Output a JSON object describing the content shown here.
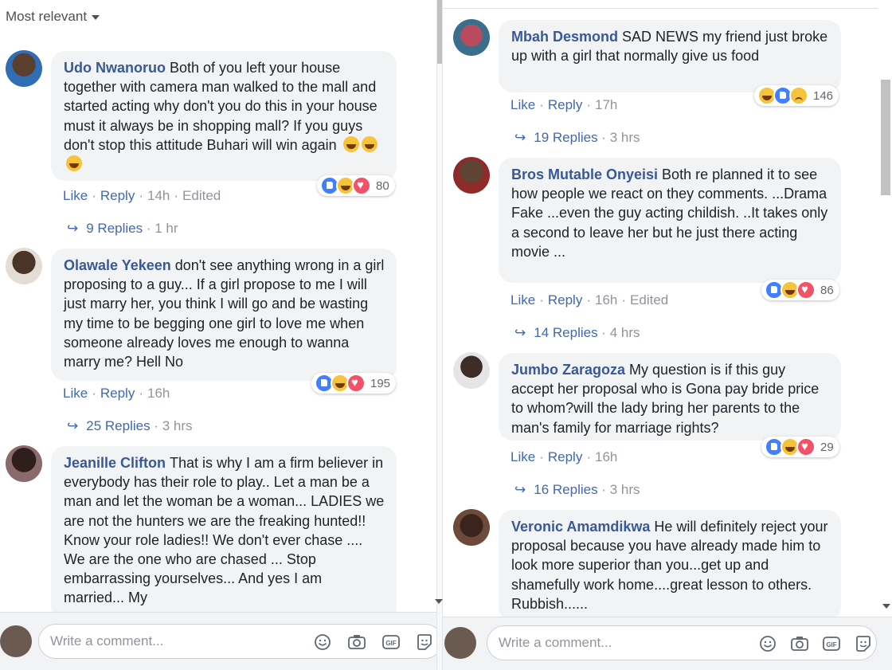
{
  "left": {
    "sort_label": "Most relevant",
    "comments": [
      {
        "name": "Udo Nwanoruo",
        "text": "Both of you left your house together with camera man walked to the mall and started acting why don't you do this in your house must it always be in shopping mall? If you guys don't stop this attitude Buhari will win again",
        "emoji": [
          "grinning-squint-emoji",
          "grinning-squint-emoji",
          "grinning-squint-emoji"
        ],
        "reactions": [
          "like",
          "haha",
          "love"
        ],
        "reaction_count": "80",
        "like": "Like",
        "reply": "Reply",
        "time": "14h",
        "edited": "Edited",
        "replies_label": "9 Replies",
        "replies_time": "1 hr"
      },
      {
        "name": "Olawale Yekeen",
        "text": "don't see anything wrong in a girl proposing to a guy... If a girl propose to me I will just marry her, you think I will go and be wasting my time to be begging one girl to love me when someone already loves me enough to wanna marry me? Hell No",
        "reactions": [
          "like",
          "haha",
          "love"
        ],
        "reaction_count": "195",
        "like": "Like",
        "reply": "Reply",
        "time": "16h",
        "replies_label": "25 Replies",
        "replies_time": "3 hrs"
      },
      {
        "name": "Jeanille Clifton",
        "text": "That is why I am a firm believer in everybody has their role to play.. Let a man be a man and let the woman be a woman... LADIES we are not the hunters we are the freaking hunted!! Know your role ladies!! We don't ever chase .... We are the one who are chased ... Stop embarrassing yourselves... And yes I am married... My"
      }
    ],
    "write_placeholder": "Write a comment..."
  },
  "right": {
    "comments": [
      {
        "name": "Mbah Desmond",
        "text": "SAD NEWS my friend just broke up with a girl that normally give us food",
        "reactions": [
          "haha",
          "like",
          "sad"
        ],
        "reaction_count": "146",
        "like": "Like",
        "reply": "Reply",
        "time": "17h",
        "replies_label": "19 Replies",
        "replies_time": "3 hrs"
      },
      {
        "name": "Bros Mutable Onyeisi",
        "text": "Both re planned it to see how people we react on they comments. ...Drama Fake ...even the guy acting childish. ..It takes only a second to leave her but he just there acting movie ...",
        "reactions": [
          "like",
          "haha",
          "love"
        ],
        "reaction_count": "86",
        "like": "Like",
        "reply": "Reply",
        "time": "16h",
        "edited": "Edited",
        "replies_label": "14 Replies",
        "replies_time": "4 hrs"
      },
      {
        "name": "Jumbo Zaragoza",
        "text": "My question is if this guy accept her proposal who is Gona pay bride price to whom?will the lady bring her parents to the man's family for marriage rights?",
        "reactions": [
          "like",
          "haha",
          "love"
        ],
        "reaction_count": "29",
        "like": "Like",
        "reply": "Reply",
        "time": "16h",
        "replies_label": "16 Replies",
        "replies_time": "3 hrs"
      },
      {
        "name": "Veronic Amamdikwa",
        "text": "He will definitely reject your proposal because you have already made him to look more superior than you...get up and shamefully work home....great lesson to others. Rubbish......"
      }
    ],
    "write_placeholder": "Write a comment..."
  },
  "composer_icons": [
    "smiley-icon",
    "camera-icon",
    "gif-icon",
    "sticker-icon"
  ],
  "gif_label": "GIF",
  "colors": {
    "name_blue": "#385898",
    "link_blue": "#4267b2",
    "bubble_bg": "#f2f3f5",
    "meta_gray": "#90949c"
  }
}
